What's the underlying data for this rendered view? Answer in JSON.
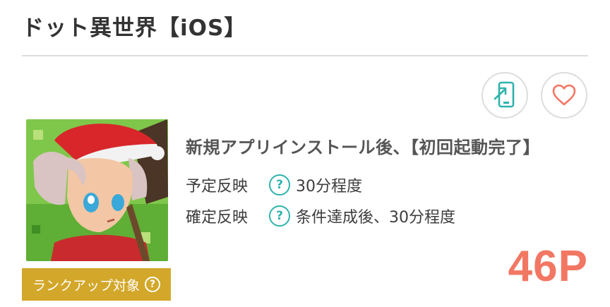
{
  "header": {
    "title": "ドット異世界【iOS】"
  },
  "actions": {
    "device_icon": "smartphone-arrow-icon",
    "favorite_icon": "heart-icon"
  },
  "app": {
    "icon": "app-icon-santa-character",
    "condition": "新規アプリインストール後、【初回起動完了】",
    "rank_badge": {
      "label": "ランクアップ対象",
      "help": "?"
    }
  },
  "details": [
    {
      "label": "予定反映",
      "help": "?",
      "value": "30分程度"
    },
    {
      "label": "確定反映",
      "help": "?",
      "value": "条件達成後、30分程度"
    }
  ],
  "reward": {
    "points": "46P"
  },
  "colors": {
    "accent_teal": "#2eb3ad",
    "heart": "#f27763",
    "points": "#f27763",
    "badge": "#d3a72a",
    "divider": "#dcdcdc"
  }
}
